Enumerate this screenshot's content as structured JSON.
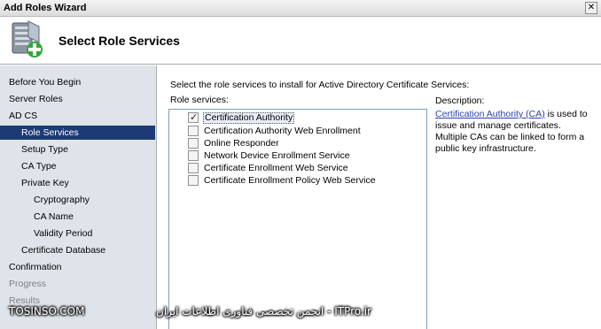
{
  "window": {
    "title": "Add Roles Wizard",
    "close_glyph": "✕"
  },
  "header": {
    "title": "Select Role Services",
    "icon": "server-add-icon"
  },
  "nav": {
    "items": [
      {
        "label": "Before You Begin",
        "state": "normal"
      },
      {
        "label": "Server Roles",
        "state": "normal"
      },
      {
        "label": "AD CS",
        "state": "normal"
      },
      {
        "label": "Role Services",
        "state": "selected"
      },
      {
        "label": "Setup Type",
        "state": "normal"
      },
      {
        "label": "CA Type",
        "state": "normal"
      },
      {
        "label": "Private Key",
        "state": "normal"
      },
      {
        "label": "Cryptography",
        "state": "normal"
      },
      {
        "label": "CA Name",
        "state": "normal"
      },
      {
        "label": "Validity Period",
        "state": "normal"
      },
      {
        "label": "Certificate Database",
        "state": "normal"
      },
      {
        "label": "Confirmation",
        "state": "normal"
      },
      {
        "label": "Progress",
        "state": "disabled"
      },
      {
        "label": "Results",
        "state": "disabled"
      }
    ]
  },
  "content": {
    "instruction": "Select the role services to install for Active Directory Certificate Services:",
    "roles_label": "Role services:",
    "roles": [
      {
        "label": "Certification Authority",
        "checked": true
      },
      {
        "label": "Certification Authority Web Enrollment",
        "checked": false
      },
      {
        "label": "Online Responder",
        "checked": false
      },
      {
        "label": "Network Device Enrollment Service",
        "checked": false
      },
      {
        "label": "Certificate Enrollment Web Service",
        "checked": false
      },
      {
        "label": "Certificate Enrollment Policy Web Service",
        "checked": false
      }
    ],
    "description_label": "Description:",
    "description_link": "Certification Authority (CA)",
    "description_text": " is used to issue and manage certificates. Multiple CAs can be linked to form a public key infrastructure."
  },
  "watermark": {
    "left": "TOSINSO.COM",
    "right": "انجمن تخصصی فناوری اطلاعات ایران - ITPro.ir"
  },
  "colors": {
    "nav_bg": "#dfe4ea",
    "selected_bg": "#1c3a74",
    "link": "#2a3eab"
  }
}
